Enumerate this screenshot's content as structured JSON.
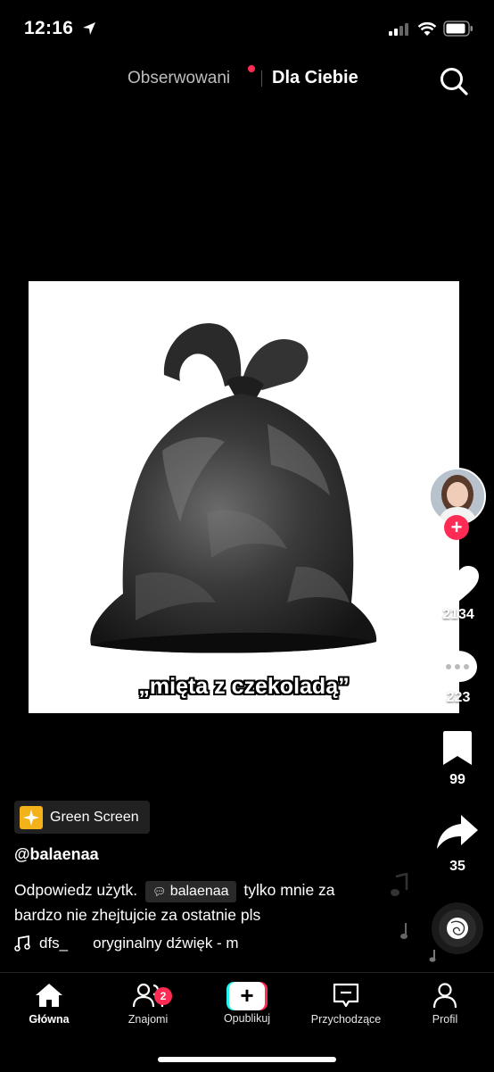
{
  "status_bar": {
    "time": "12:16"
  },
  "top_tabs": {
    "following": "Obserwowani",
    "for_you": "Dla Ciebie"
  },
  "video": {
    "caption": "„mięta z czekoladą”"
  },
  "actions": {
    "likes": "2134",
    "comments": "223",
    "saves": "99",
    "shares": "35"
  },
  "effect": {
    "label": "Green Screen"
  },
  "post": {
    "username": "@balaenaa",
    "desc_prefix": "Odpowiedz użytk.",
    "mention": "balaenaa",
    "desc_suffix": "tylko mnie za bardzo nie zhejtujcie za ostatnie pls",
    "music_author": "dfs_",
    "music_title": "oryginalny dźwięk - m"
  },
  "nav": {
    "home": "Główna",
    "friends": "Znajomi",
    "friends_badge": "2",
    "publish": "Opublikuj",
    "inbox": "Przychodzące",
    "profile": "Profil"
  },
  "colors": {
    "accent": "#fe2c55",
    "cyan": "#25f4ee",
    "effect_icon": "#f3b21a"
  }
}
